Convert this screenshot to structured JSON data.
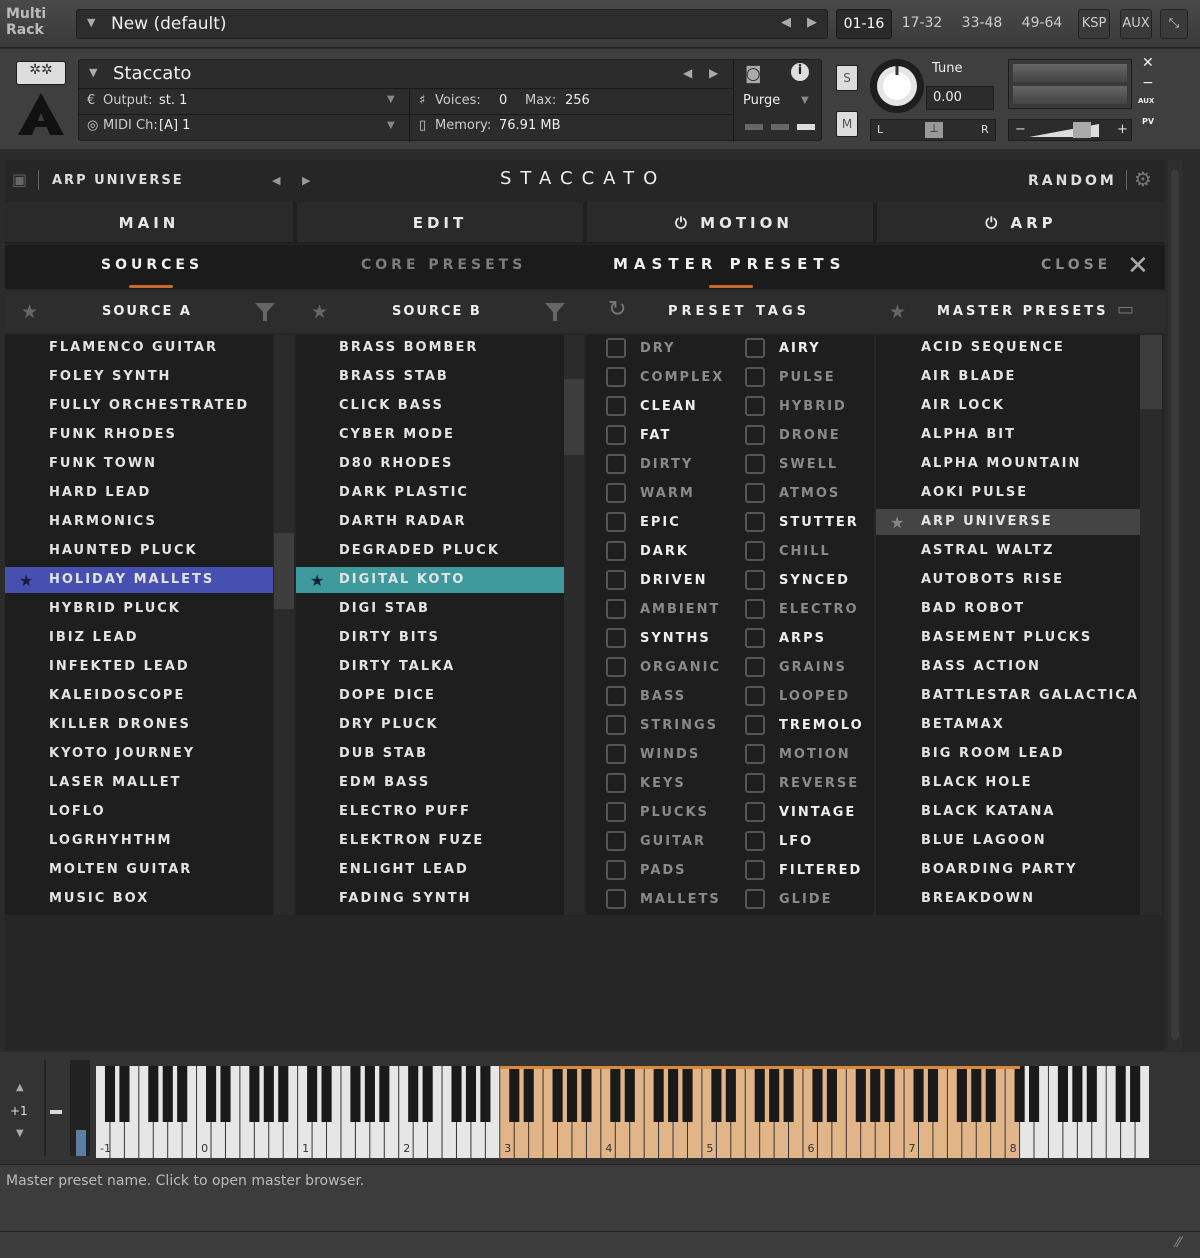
{
  "topbar": {
    "multi_rack": "Multi\nRack",
    "multi_rack_l1": "Multi",
    "multi_rack_l2": "Rack",
    "rack_name": "New (default)",
    "pages": [
      "01-16",
      "17-32",
      "33-48",
      "49-64"
    ],
    "ksp": "KSP",
    "aux": "AUX"
  },
  "instrument": {
    "name": "Staccato",
    "output_label": "Output:",
    "output_value": "st. 1",
    "midi_label": "MIDI Ch:",
    "midi_value": "[A]  1",
    "voices_label": "Voices:",
    "voices_value": "0",
    "max_label": "Max:",
    "max_value": "256",
    "memory_label": "Memory:",
    "memory_value": "76.91 MB",
    "purge": "Purge",
    "s": "S",
    "m": "M",
    "tune_label": "Tune",
    "tune_value": "0.00",
    "pan_l": "L",
    "pan_r": "R",
    "aux_small": "AUX",
    "pv_small": "PV"
  },
  "header": {
    "preset_name": "ARP UNIVERSE",
    "title": "STACCATO",
    "random": "RANDOM"
  },
  "nav": {
    "tabs": [
      "MAIN",
      "EDIT",
      "MOTION",
      "ARP"
    ]
  },
  "sub": {
    "sources": "SOURCES",
    "core_presets": "CORE PRESETS",
    "master_presets": "MASTER PRESETS",
    "close": "CLOSE"
  },
  "columns": {
    "source_a": "SOURCE A",
    "source_b": "SOURCE B",
    "preset_tags": "PRESET TAGS",
    "master_presets": "MASTER PRESETS"
  },
  "source_a": [
    "FLAMENCO GUITAR",
    "FOLEY SYNTH",
    "FULLY ORCHESTRATED",
    "FUNK RHODES",
    "FUNK TOWN",
    "HARD LEAD",
    "HARMONICS",
    "HAUNTED PLUCK",
    "HOLIDAY MALLETS",
    "HYBRID PLUCK",
    "IBIZ LEAD",
    "INFEKTED LEAD",
    "KALEIDOSCOPE",
    "KILLER DRONES",
    "KYOTO JOURNEY",
    "LASER MALLET",
    "LOFLO",
    "LOGRHYHTHM",
    "MOLTEN GUITAR",
    "MUSIC BOX"
  ],
  "source_b": [
    "BRASS BOMBER",
    "BRASS STAB",
    "CLICK BASS",
    "CYBER MODE",
    "D80 RHODES",
    "DARK PLASTIC",
    "DARTH RADAR",
    "DEGRADED PLUCK",
    "DIGITAL KOTO",
    "DIGI STAB",
    "DIRTY BITS",
    "DIRTY TALKA",
    "DOPE DICE",
    "DRY PLUCK",
    "DUB STAB",
    "EDM BASS",
    "ELECTRO PUFF",
    "ELEKTRON FUZE",
    "ENLIGHT LEAD",
    "FADING SYNTH"
  ],
  "tags_left": [
    "DRY",
    "COMPLEX",
    "CLEAN",
    "FAT",
    "DIRTY",
    "WARM",
    "EPIC",
    "DARK",
    "DRIVEN",
    "AMBIENT",
    "SYNTHS",
    "ORGANIC",
    "BASS",
    "STRINGS",
    "WINDS",
    "KEYS",
    "PLUCKS",
    "GUITAR",
    "PADS",
    "MALLETS"
  ],
  "tags_right": [
    "AIRY",
    "PULSE",
    "HYBRID",
    "DRONE",
    "SWELL",
    "ATMOS",
    "STUTTER",
    "CHILL",
    "SYNCED",
    "ELECTRO",
    "ARPS",
    "GRAINS",
    "LOOPED",
    "TREMOLO",
    "MOTION",
    "REVERSE",
    "VINTAGE",
    "LFO",
    "FILTERED",
    "GLIDE"
  ],
  "master_list": [
    "ACID SEQUENCE",
    "AIR BLADE",
    "AIR LOCK",
    "ALPHA BIT",
    "ALPHA MOUNTAIN",
    "AOKI PULSE",
    "ARP UNIVERSE",
    "ASTRAL WALTZ",
    "AUTOBOTS RISE",
    "BAD ROBOT",
    "BASEMENT PLUCKS",
    "BASS ACTION",
    "BATTLESTAR GALACTICA",
    "BETAMAX",
    "BIG ROOM LEAD",
    "BLACK HOLE",
    "BLACK KATANA",
    "BLUE LAGOON",
    "BOARDING PARTY",
    "BREAKDOWN"
  ],
  "keyboard": {
    "octave_shift": "+1",
    "octaves": [
      "-1",
      "0",
      "1",
      "2",
      "3",
      "4",
      "5",
      "6",
      "7",
      "8"
    ]
  },
  "status": "Master preset name.  Click to open master browser.",
  "colors": {
    "source_a_selected": "#4750b0",
    "source_b_selected": "#3f9a9d",
    "accent_underline": "#c96a2c",
    "key_range": "#e2b589"
  }
}
